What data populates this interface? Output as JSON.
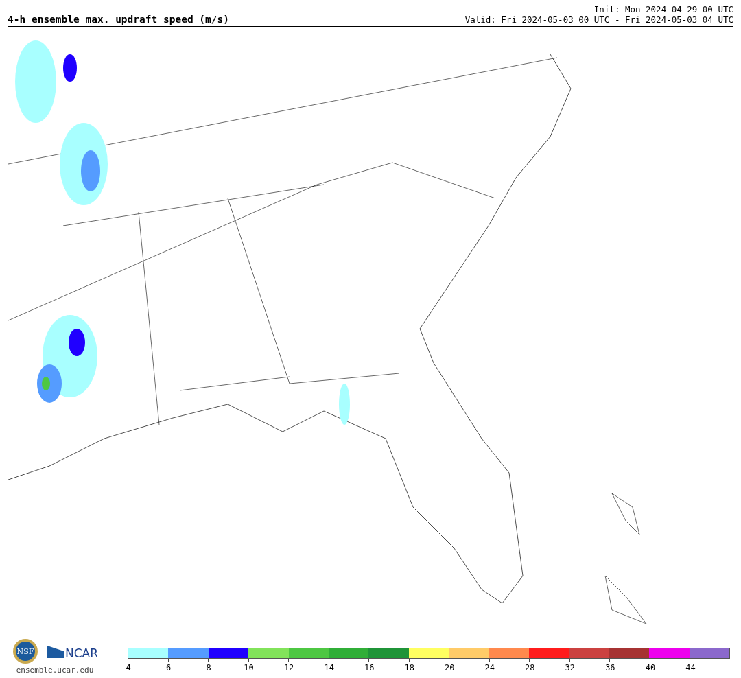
{
  "header": {
    "title": "4-h ensemble max. updraft speed (m/s)",
    "init": "Init: Mon 2024-04-29 00 UTC",
    "valid": "Valid: Fri 2024-05-03 00 UTC - Fri 2024-05-03 04 UTC"
  },
  "footer": {
    "nsf_logo": "NSF",
    "ncar_logo": "NCAR",
    "website": "ensemble.ucar.edu"
  },
  "colorbar": {
    "segments": [
      {
        "color": "#a8ffff"
      },
      {
        "color": "#559cff"
      },
      {
        "color": "#2000ff"
      },
      {
        "color": "#82e35a"
      },
      {
        "color": "#4ec742"
      },
      {
        "color": "#30ae37"
      },
      {
        "color": "#1f9438"
      },
      {
        "color": "#ffff60"
      },
      {
        "color": "#ffcb68"
      },
      {
        "color": "#ff894d"
      },
      {
        "color": "#ff1c1c"
      },
      {
        "color": "#cb4140"
      },
      {
        "color": "#a63232"
      },
      {
        "color": "#ed00ed"
      },
      {
        "color": "#8b68cc"
      }
    ],
    "ticks": [
      "4",
      "6",
      "8",
      "10",
      "12",
      "14",
      "16",
      "18",
      "20",
      "24",
      "28",
      "32",
      "36",
      "40",
      "44"
    ]
  }
}
